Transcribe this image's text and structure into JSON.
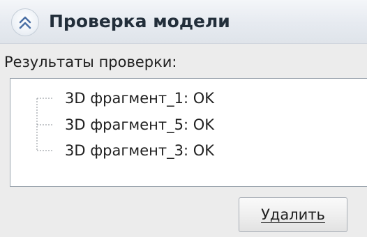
{
  "panel": {
    "title": "Проверка модели",
    "collapse_icon": "chevron-double-up-icon"
  },
  "results": {
    "label": "Результаты проверки:",
    "items": [
      {
        "name": "3D фрагмент_1:",
        "status": "OK"
      },
      {
        "name": "3D фрагмент_5:",
        "status": "OK"
      },
      {
        "name": "3D фрагмент_3:",
        "status": "OK"
      }
    ]
  },
  "actions": {
    "delete_label": "Удалить"
  },
  "colors": {
    "header_bg": "#e6eaf0",
    "panel_bg": "#ececec",
    "title_text": "#222e3a",
    "icon_blue": "#4a6fa5"
  }
}
